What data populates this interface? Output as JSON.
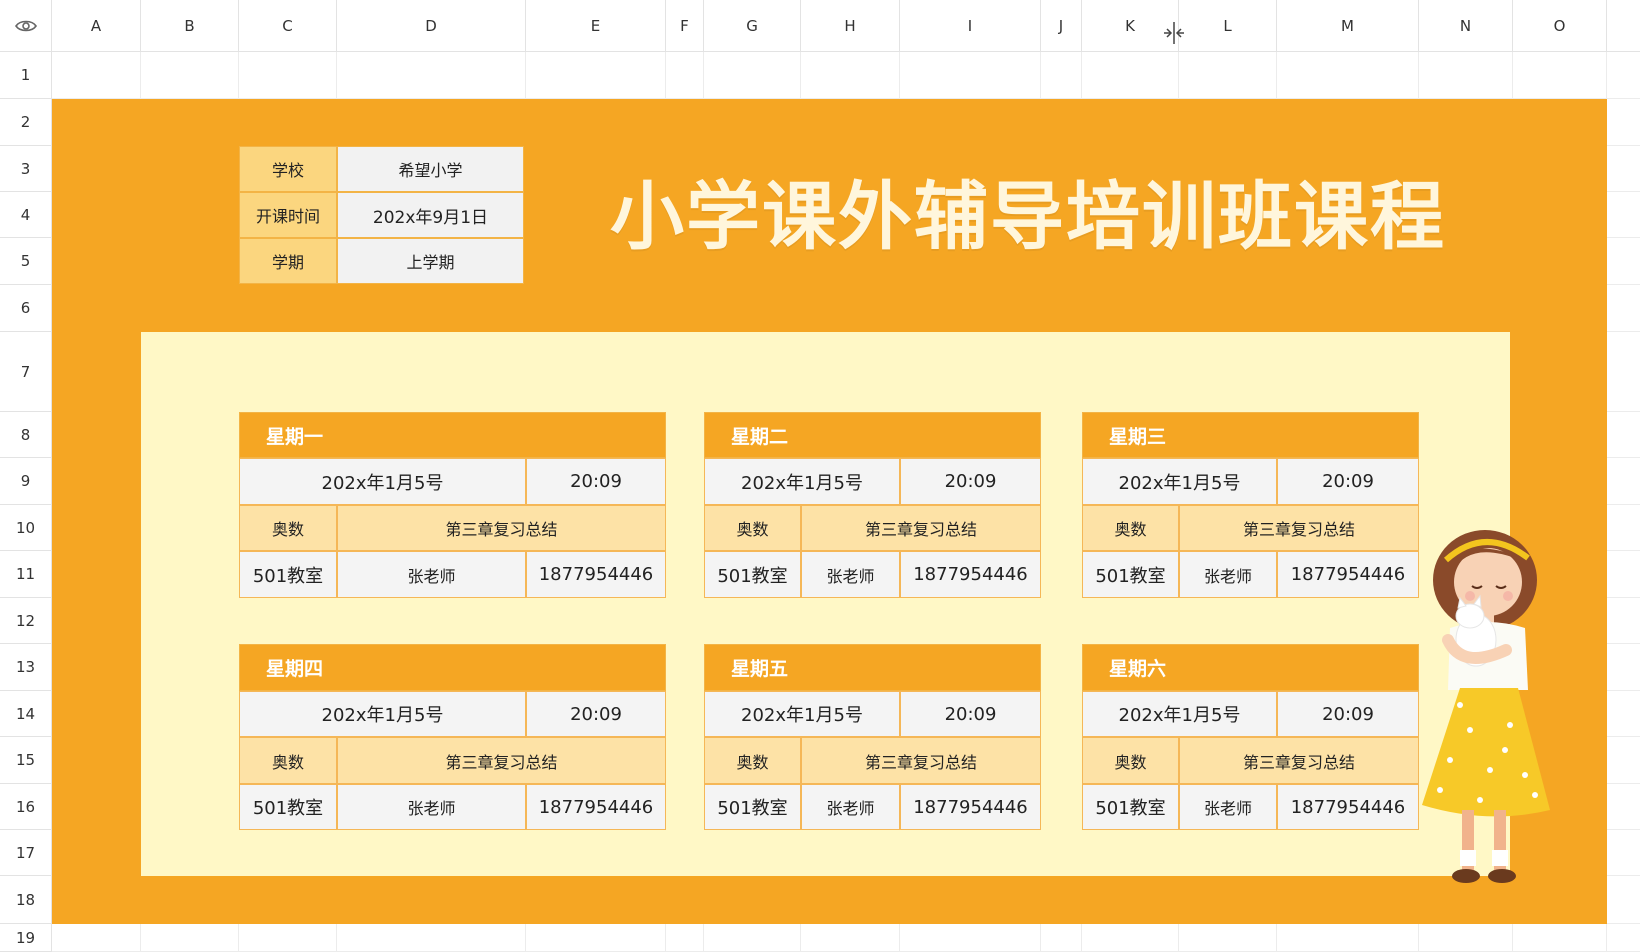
{
  "columns": [
    "A",
    "B",
    "C",
    "D",
    "E",
    "F",
    "G",
    "H",
    "I",
    "J",
    "K",
    "L",
    "M",
    "N",
    "O"
  ],
  "rows": [
    "1",
    "2",
    "3",
    "4",
    "5",
    "6",
    "7",
    "8",
    "9",
    "10",
    "11",
    "12",
    "13",
    "14",
    "15",
    "16",
    "17",
    "18",
    "19"
  ],
  "info": {
    "school_label": "学校",
    "school_value": "希望小学",
    "start_label": "开课时间",
    "start_value": "202x年9月1日",
    "term_label": "学期",
    "term_value": "上学期"
  },
  "title": "小学课外辅导培训班课程",
  "schedule": [
    {
      "day": "星期一",
      "date": "202x年1月5号",
      "time": "20:09",
      "subject": "奥数",
      "topic": "第三章复习总结",
      "room": "501教室",
      "teacher": "张老师",
      "phone": "1877954446"
    },
    {
      "day": "星期二",
      "date": "202x年1月5号",
      "time": "20:09",
      "subject": "奥数",
      "topic": "第三章复习总结",
      "room": "501教室",
      "teacher": "张老师",
      "phone": "1877954446"
    },
    {
      "day": "星期三",
      "date": "202x年1月5号",
      "time": "20:09",
      "subject": "奥数",
      "topic": "第三章复习总结",
      "room": "501教室",
      "teacher": "张老师",
      "phone": "1877954446"
    },
    {
      "day": "星期四",
      "date": "202x年1月5号",
      "time": "20:09",
      "subject": "奥数",
      "topic": "第三章复习总结",
      "room": "501教室",
      "teacher": "张老师",
      "phone": "1877954446"
    },
    {
      "day": "星期五",
      "date": "202x年1月5号",
      "time": "20:09",
      "subject": "奥数",
      "topic": "第三章复习总结",
      "room": "501教室",
      "teacher": "张老师",
      "phone": "1877954446"
    },
    {
      "day": "星期六",
      "date": "202x年1月5号",
      "time": "20:09",
      "subject": "奥数",
      "topic": "第三章复习总结",
      "room": "501教室",
      "teacher": "张老师",
      "phone": "1877954446"
    }
  ],
  "colors": {
    "orange": "#f5a623",
    "panel": "#fff8c6",
    "peach": "#fde2a6",
    "key": "#fbd67f"
  },
  "icons": {
    "corner": "eye-icon",
    "cursor": "column-resize-cursor-icon",
    "illustration": "girl-holding-cat-illustration"
  }
}
